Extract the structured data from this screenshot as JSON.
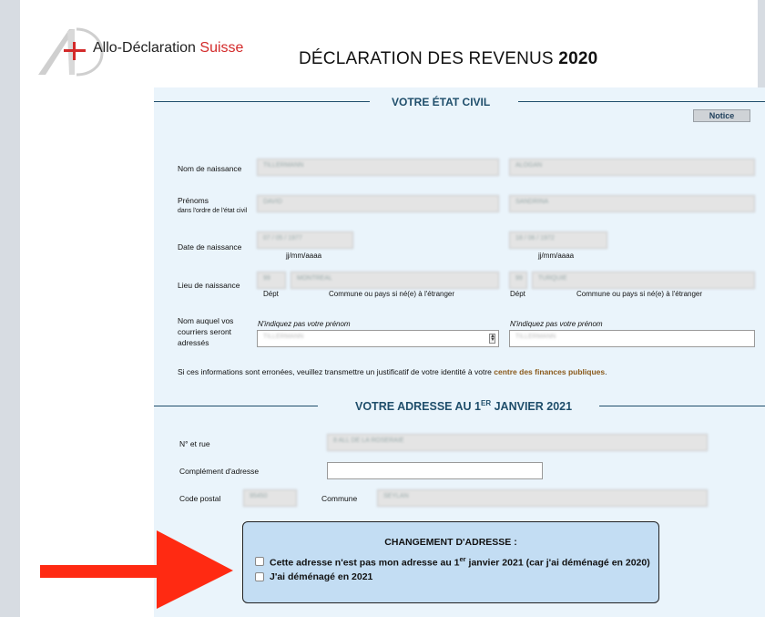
{
  "brand": {
    "logo_main": "Allo-Déclaration ",
    "logo_accent": "Suisse"
  },
  "page_title": {
    "prefix": "DÉCLARATION DES REVENUS ",
    "year": "2020"
  },
  "etat_civil": {
    "section_title": "VOTRE ÉTAT CIVIL",
    "notice_label": "Notice",
    "nom_naissance_label": "Nom de naissance",
    "nom_naissance": [
      "TILLERMANN",
      "ALOGAN"
    ],
    "prenoms_label": "Prénoms",
    "prenoms_sublabel": "dans l'ordre de l'état civil",
    "prenoms": [
      "DAVID",
      "SANDRINA"
    ],
    "date_naissance_label": "Date de naissance",
    "date_naissance": [
      "07 / 05 / 1977",
      "18 / 06 / 1972"
    ],
    "date_format": "jj/mm/aaaa",
    "lieu_label": "Lieu de naissance",
    "lieu_dept": [
      "99",
      "99"
    ],
    "lieu_commune": [
      "MONTREAL",
      "TURQUIE"
    ],
    "dept_hint": "Dépt",
    "commune_hint": "Commune ou pays si né(e) à l'étranger",
    "courrier_label": "Nom auquel vos courriers seront adressés",
    "courrier_hint": "N'indiquez pas votre prénom",
    "courrier": [
      "TILLERMANN",
      "TILLERMANN"
    ],
    "info_text": "Si ces informations sont erronées, veuillez transmettre un justificatif de votre identité à votre ",
    "info_link": "centre des finances publiques",
    "info_end": "."
  },
  "adresse": {
    "section_title_a": "VOTRE ADRESSE AU 1",
    "section_title_sup": "ER",
    "section_title_b": " JANVIER 2021",
    "rue_label": "N° et rue",
    "rue": "8 ALL DE LA ROSERAIE",
    "complement_label": "Complément d'adresse",
    "complement": "",
    "code_postal_label": "Code postal",
    "code_postal": "95450",
    "commune_label": "Commune",
    "commune": "SEYLAN"
  },
  "changement": {
    "title": "CHANGEMENT D'ADRESSE :",
    "option1_a": "Cette adresse n'est pas mon adresse au 1",
    "option1_sup": "er",
    "option1_b": " janvier 2021 (car j'ai déménagé en 2020)",
    "option2": "J'ai déménagé en 2021"
  },
  "colors": {
    "section": "#1f4e6b",
    "form_bg": "#eaf4fb",
    "box_bg": "#c3ddf3",
    "arrow": "#ff2a12",
    "link": "#8a5a1c"
  },
  "icons": {
    "logo": "allo-declaration-logo",
    "arrow": "red-pointer-arrow",
    "stepper": "stepper-icon"
  }
}
